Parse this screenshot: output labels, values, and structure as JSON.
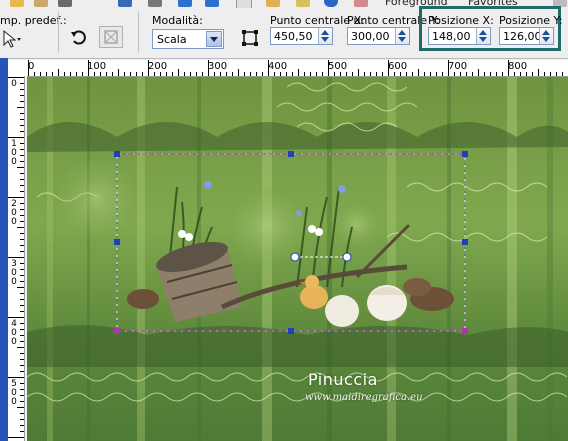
{
  "toolbar": {
    "top_partial_texts": [
      "Foreground",
      "Favorites"
    ],
    "preset_label": "mp. predef.:",
    "mode_label": "Modalità:",
    "mode_value": "Scala",
    "center_x_label": "Punto centrale X:",
    "center_x_value": "450,50",
    "center_y_label": "Punto centrale Y:",
    "center_y_value": "300,00",
    "position_x_label": "Posizione X:",
    "position_x_value": "148,00",
    "position_y_label": "Posizione Y:",
    "position_y_value": "126,00"
  },
  "ruler_top": [
    "0",
    "100",
    "200",
    "300",
    "400",
    "500",
    "600",
    "700",
    "800"
  ],
  "ruler_left": [
    "0",
    "1 0 0",
    "2 0 0",
    "3 0 0",
    "4 0 0",
    "5 0 0"
  ],
  "canvas": {
    "watermark_name": "Pinuccia",
    "watermark_url": "www.maidiregrafica.eu"
  },
  "colors": {
    "highlight_box": "#1f6b6b",
    "selection_handles": "#1f3fbf",
    "ruler_left_strip": "#2456b8"
  }
}
